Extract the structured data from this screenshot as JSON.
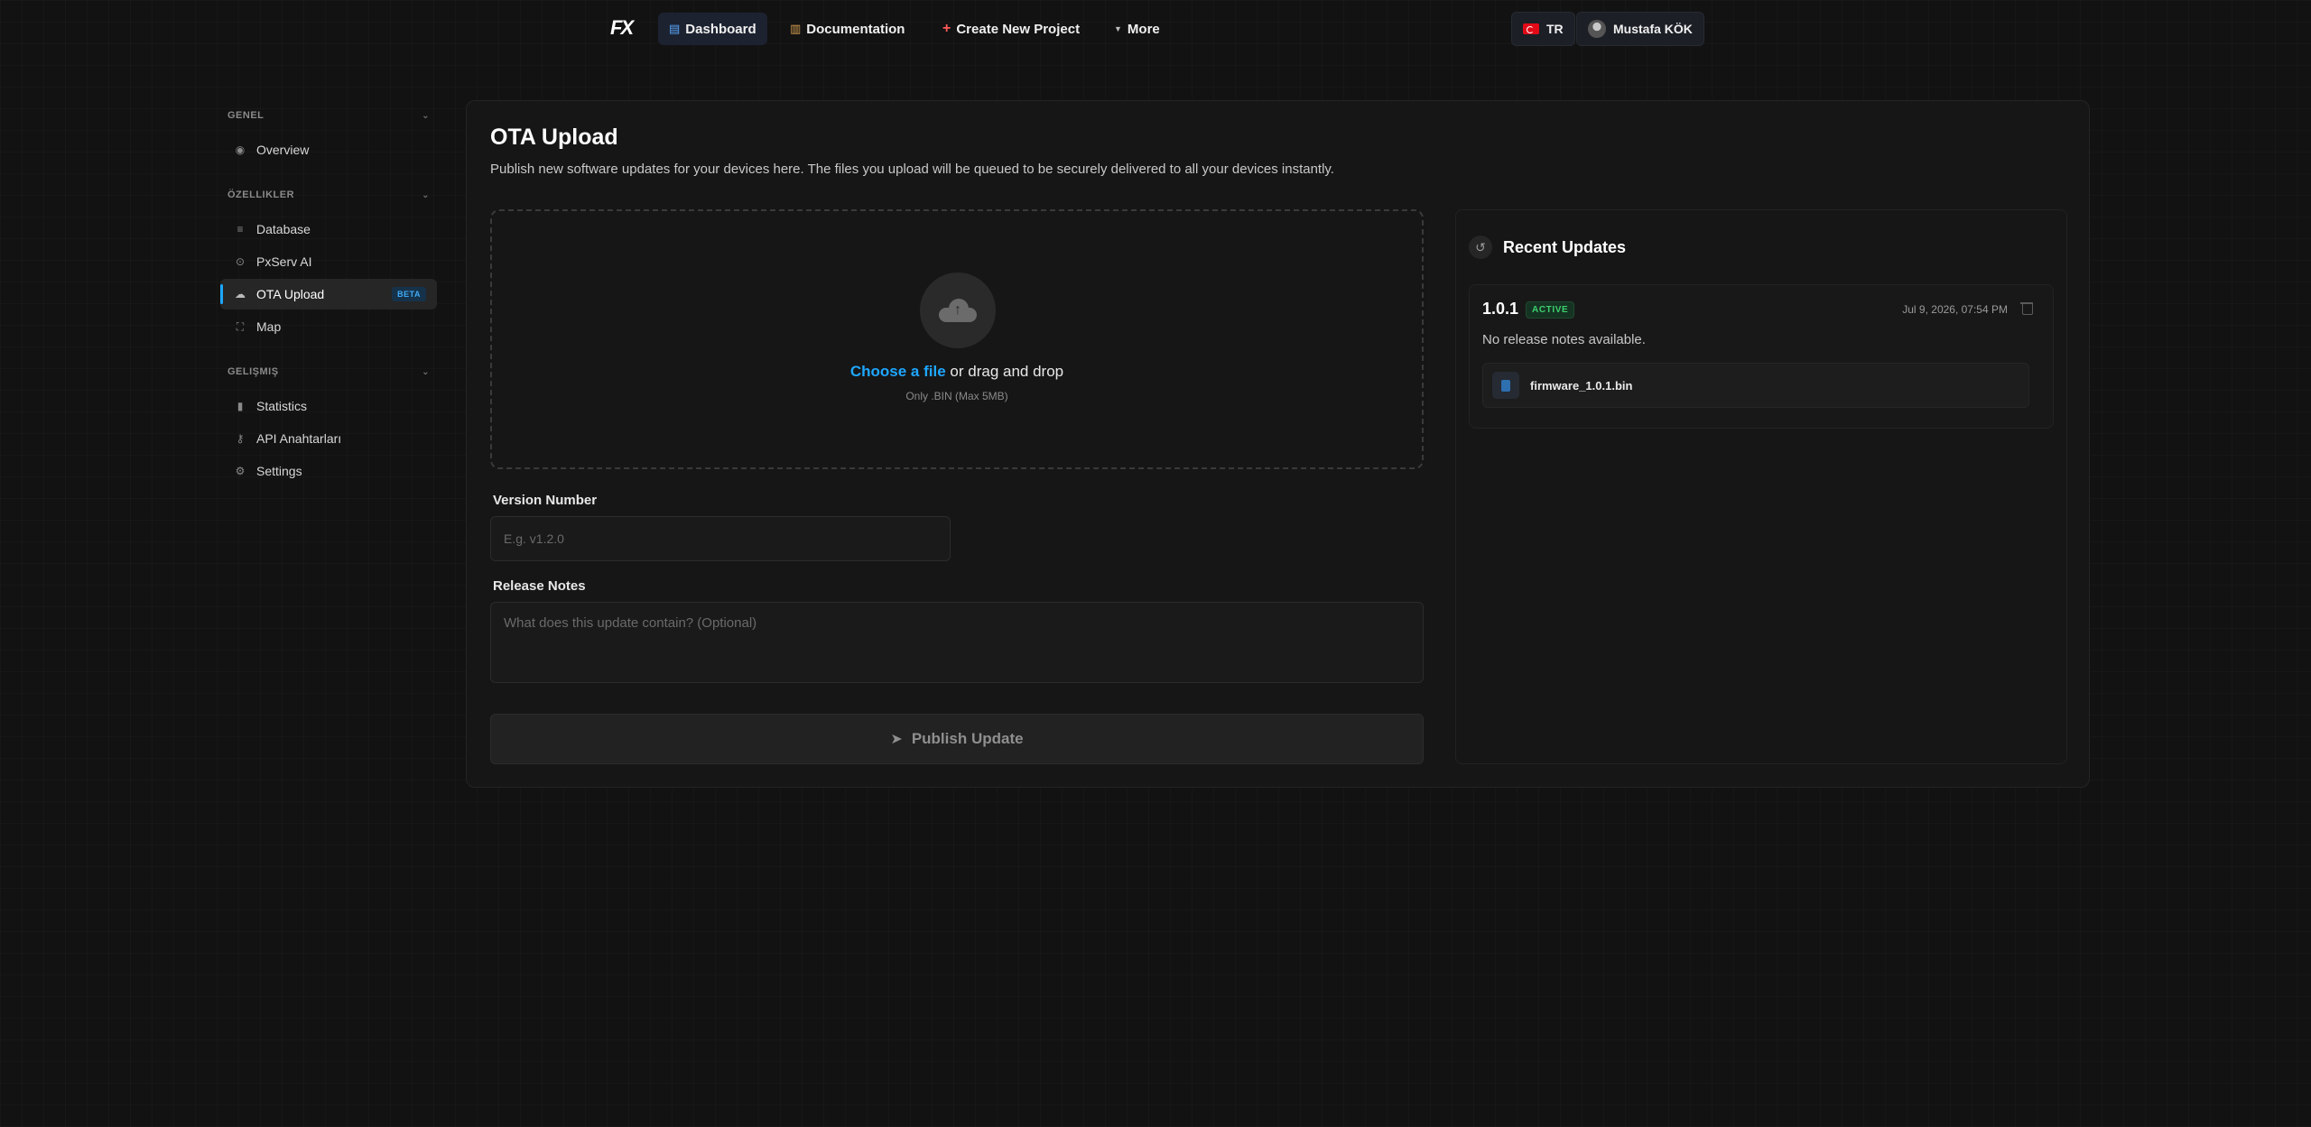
{
  "colors": {
    "accent": "#1ea7ff",
    "active_status": "#3ecf6e",
    "background": "#121212",
    "panel": "#161616"
  },
  "nav": {
    "logo_text": "FX",
    "items": [
      {
        "label": "Dashboard",
        "icon": "dashboard-icon"
      },
      {
        "label": "Documentation",
        "icon": "books-icon"
      },
      {
        "label": "Create New Project",
        "icon": "plus-icon"
      },
      {
        "label": "More",
        "icon": "chevron-down-icon"
      }
    ],
    "language": "TR",
    "user_name": "Mustafa KÖK"
  },
  "sidebar": {
    "sections": [
      {
        "title": "GENEL",
        "items": [
          {
            "label": "Overview",
            "icon": "eye-icon"
          }
        ]
      },
      {
        "title": "ÖZELLIKLER",
        "items": [
          {
            "label": "Database",
            "icon": "database-icon"
          },
          {
            "label": "PxServ AI",
            "icon": "ai-icon"
          },
          {
            "label": "OTA Upload",
            "icon": "cloud-upload-icon",
            "badge": "BETA"
          },
          {
            "label": "Map",
            "icon": "map-icon"
          }
        ]
      },
      {
        "title": "GELIŞMIŞ",
        "items": [
          {
            "label": "Statistics",
            "icon": "bar-chart-icon"
          },
          {
            "label": "API Anahtarları",
            "icon": "key-icon"
          },
          {
            "label": "Settings",
            "icon": "gear-icon"
          }
        ]
      }
    ]
  },
  "main": {
    "title": "OTA Upload",
    "subtitle": "Publish new software updates for your devices here. The files you upload will be queued to be securely delivered to all your devices instantly.",
    "dropzone": {
      "link_text": "Choose a file",
      "rest_text": " or drag and drop",
      "hint": "Only .BIN (Max 5MB)"
    },
    "version_label": "Version Number",
    "version_placeholder": "E.g. v1.2.0",
    "notes_label": "Release Notes",
    "notes_placeholder": "What does this update contain? (Optional)",
    "publish_label": "Publish Update"
  },
  "recent": {
    "title": "Recent Updates",
    "updates": [
      {
        "version": "1.0.1",
        "status": "ACTIVE",
        "date": "Jul 9, 2026, 07:54 PM",
        "notes": "No release notes available.",
        "file": "firmware_1.0.1.bin"
      }
    ]
  }
}
